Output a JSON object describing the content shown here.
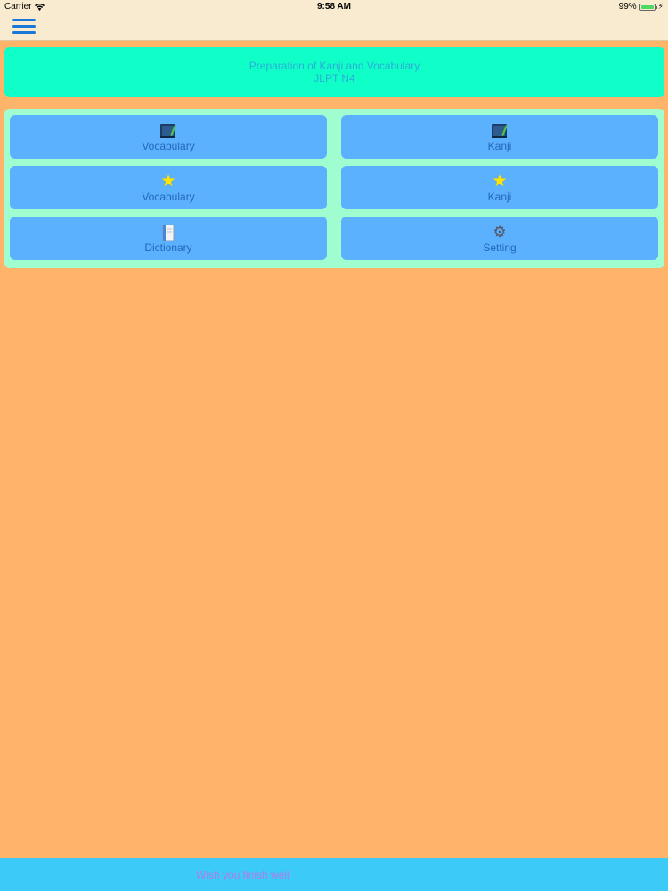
{
  "status_bar": {
    "carrier": "Carrier",
    "time": "9:58 AM",
    "battery_text": "99%",
    "battery_level": 0.99
  },
  "nav": {
    "menu_icon": "hamburger-menu-icon"
  },
  "header": {
    "line1": "Preparation of Kanji and Vocabulary",
    "line2": "JLPT N4"
  },
  "menu": {
    "items": [
      {
        "label": "Vocabulary",
        "icon": "study-book-icon"
      },
      {
        "label": "Kanji",
        "icon": "study-book-icon"
      },
      {
        "label": "Vocabulary",
        "icon": "star-icon"
      },
      {
        "label": "Kanji",
        "icon": "star-icon"
      },
      {
        "label": "Dictionary",
        "icon": "dictionary-icon"
      },
      {
        "label": "Setting",
        "icon": "gear-icon"
      }
    ]
  },
  "footer": {
    "text": "Wish you finish well"
  },
  "colors": {
    "background": "#ffb469",
    "header_bg": "#10ffc8",
    "panel_bg": "#9ffdd0",
    "tile_bg": "#5bb1fe",
    "footer_bg": "#3ccaf8"
  }
}
